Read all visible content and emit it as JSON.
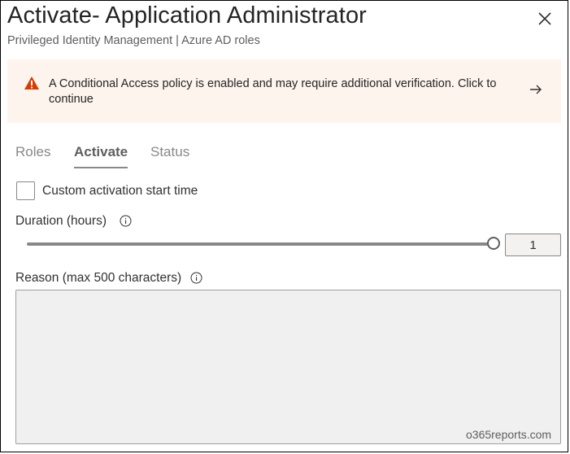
{
  "header": {
    "title": "Activate- Application Administrator",
    "subtitle": "Privileged Identity Management | Azure AD roles",
    "close_icon": "close-icon"
  },
  "banner": {
    "message": "A Conditional Access policy is enabled and may require additional verification. Click to continue",
    "warning_icon": "warning-icon",
    "arrow_icon": "arrow-right-icon",
    "warning_color": "#d83b01",
    "background": "#fdf4ee"
  },
  "tabs": [
    {
      "label": "Roles",
      "active": false
    },
    {
      "label": "Activate",
      "active": true
    },
    {
      "label": "Status",
      "active": false
    }
  ],
  "form": {
    "custom_start": {
      "label": "Custom activation start time",
      "checked": false
    },
    "duration": {
      "label": "Duration (hours)",
      "value": "1",
      "slider_fraction": 1.0,
      "info_icon": "info-icon"
    },
    "reason": {
      "label": "Reason (max 500 characters)",
      "value": "",
      "info_icon": "info-icon"
    }
  },
  "watermark": "o365reports.com"
}
